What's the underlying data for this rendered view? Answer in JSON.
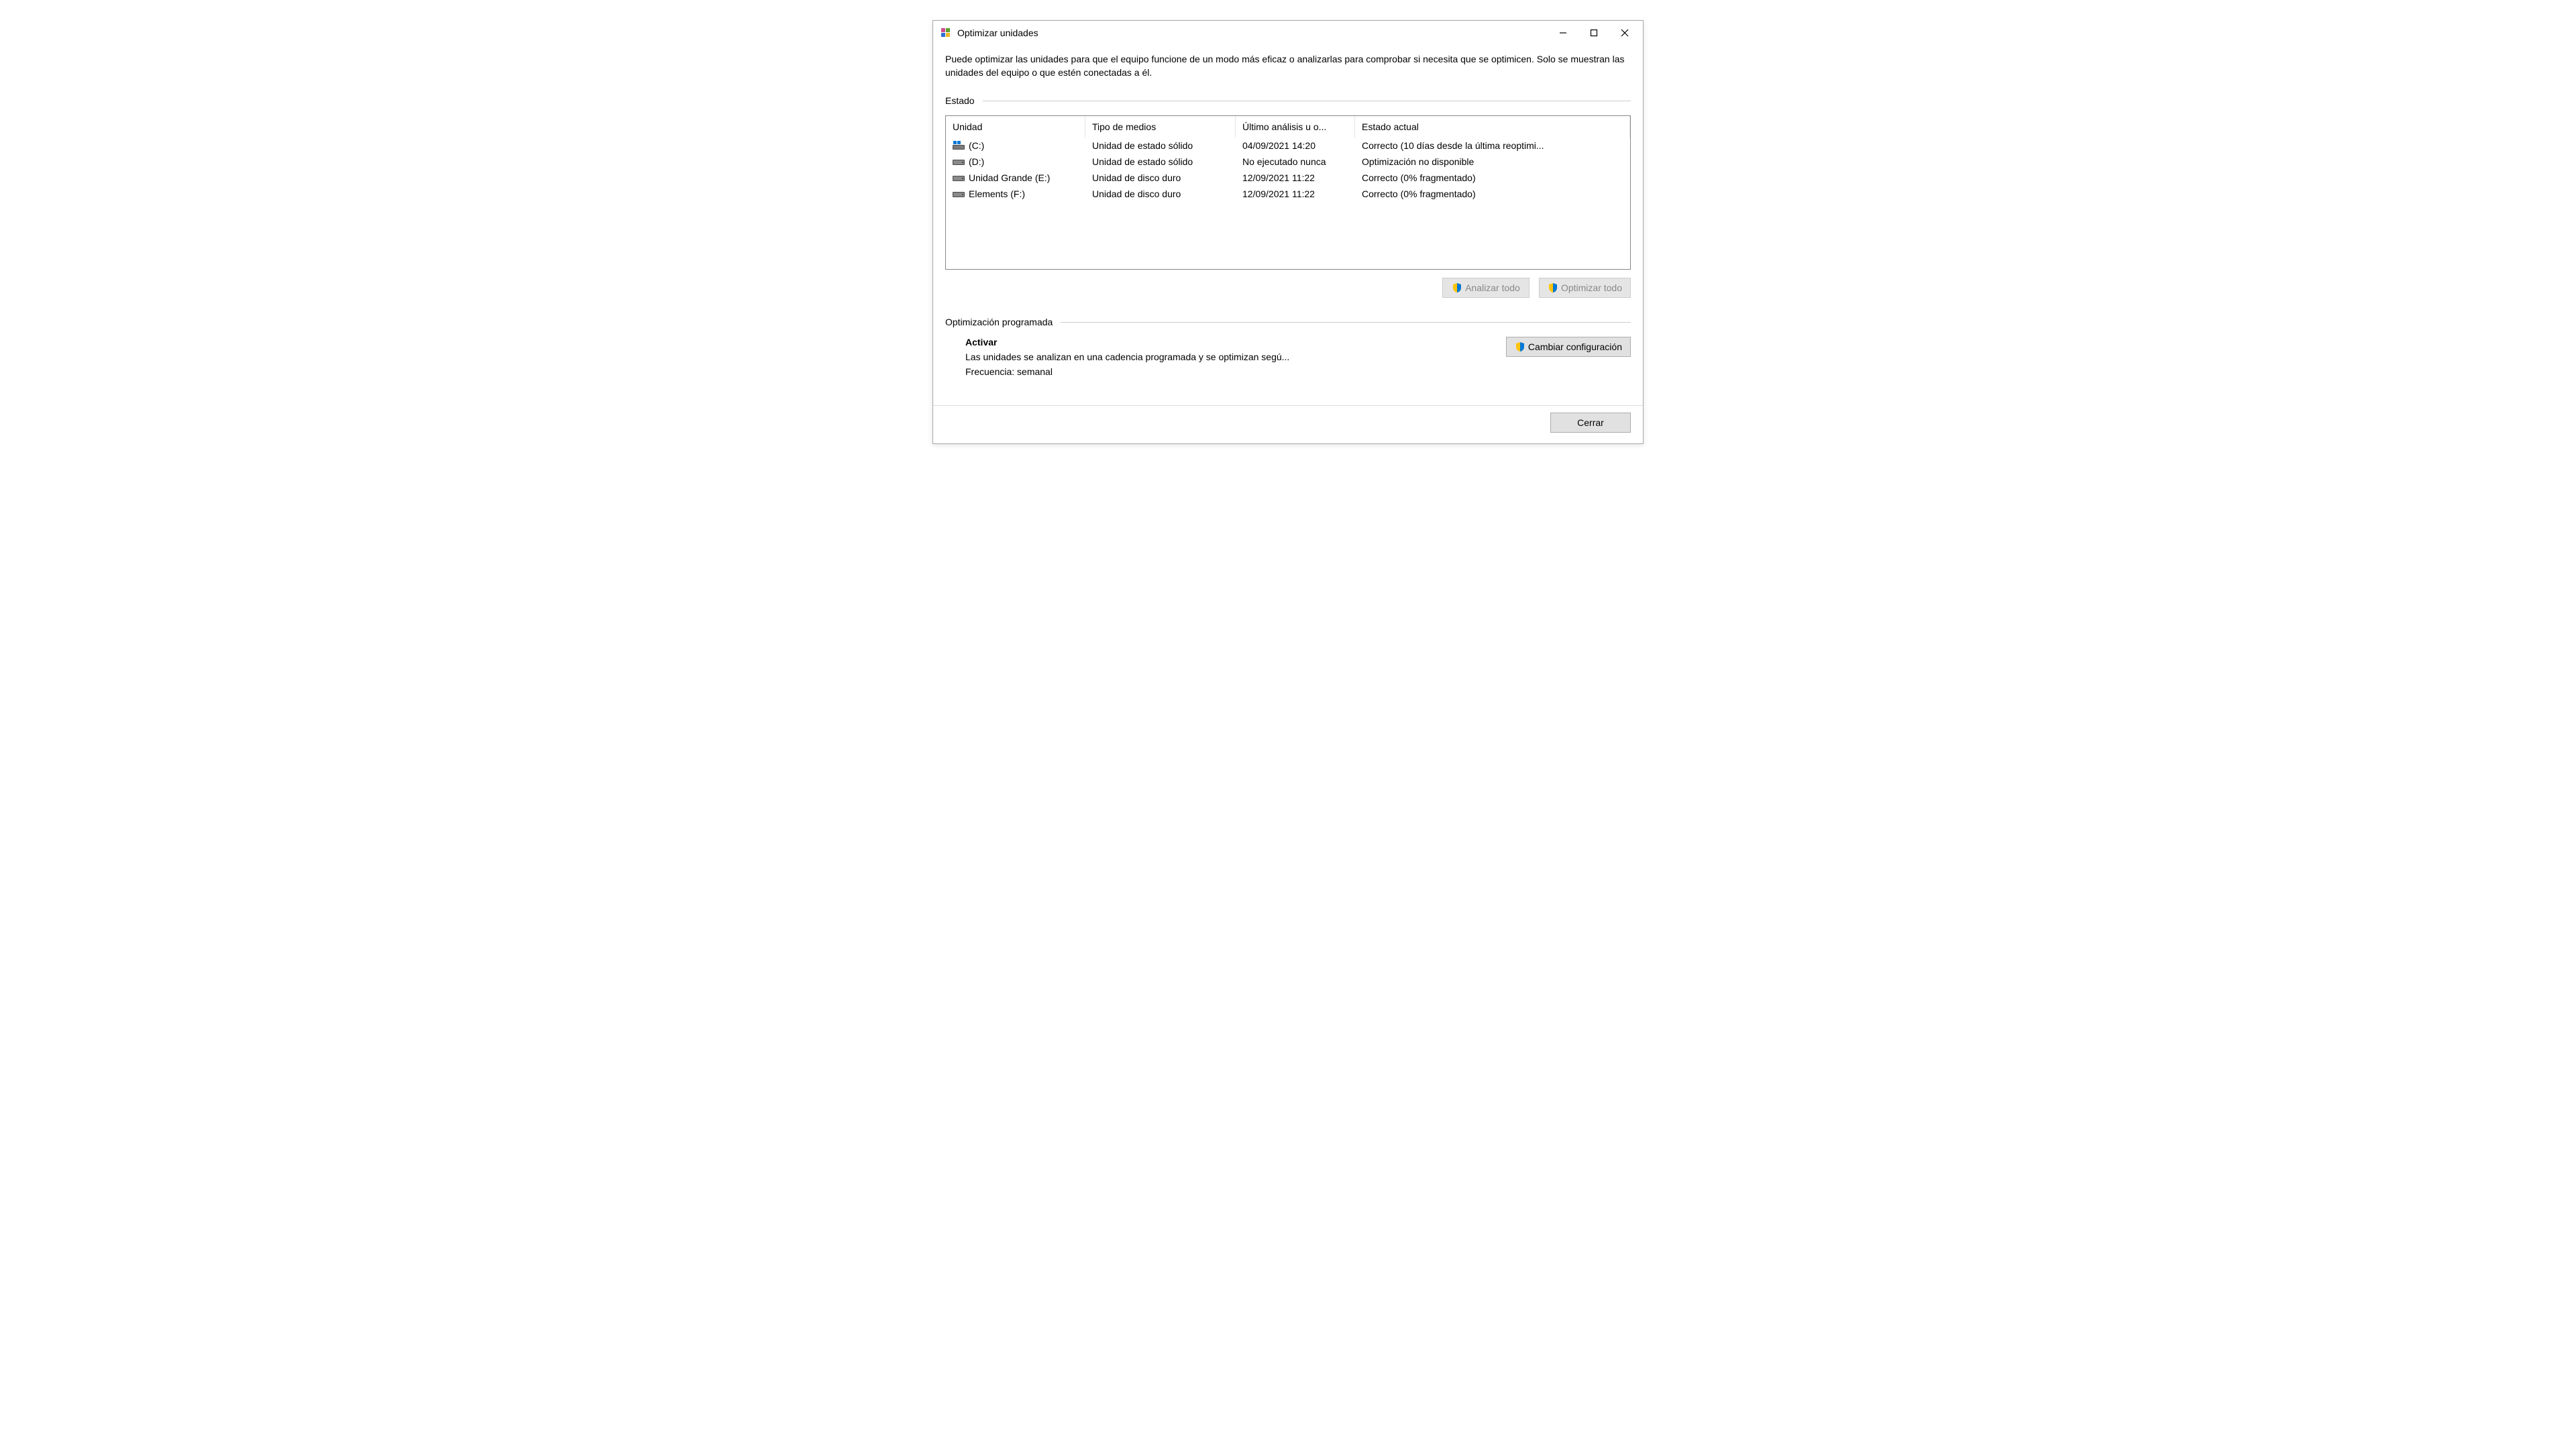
{
  "window": {
    "title": "Optimizar unidades"
  },
  "description": "Puede optimizar las unidades para que el equipo funcione de un modo más eficaz o analizarlas para comprobar si necesita que se optimicen. Solo se muestran las unidades del equipo o que estén conectadas a él.",
  "status_section": {
    "label": "Estado",
    "columns": {
      "unit": "Unidad",
      "media": "Tipo de medios",
      "last": "Último análisis u o...",
      "status": "Estado actual"
    },
    "drives": [
      {
        "icon": "windows-drive",
        "name": "(C:)",
        "media": "Unidad de estado sólido",
        "last": "04/09/2021 14:20",
        "status": "Correcto (10 días desde la última reoptimi..."
      },
      {
        "icon": "hdd",
        "name": "(D:)",
        "media": "Unidad de estado sólido",
        "last": "No ejecutado nunca",
        "status": "Optimización no disponible"
      },
      {
        "icon": "hdd",
        "name": "Unidad Grande (E:)",
        "media": "Unidad de disco duro",
        "last": "12/09/2021 11:22",
        "status": "Correcto (0% fragmentado)"
      },
      {
        "icon": "hdd",
        "name": "Elements (F:)",
        "media": "Unidad de disco duro",
        "last": "12/09/2021 11:22",
        "status": "Correcto (0% fragmentado)"
      }
    ]
  },
  "actions": {
    "analyze_all": "Analizar todo",
    "optimize_all": "Optimizar todo"
  },
  "scheduled": {
    "label": "Optimización programada",
    "title": "Activar",
    "description": "Las unidades se analizan en una cadencia programada y se optimizan segú...",
    "frequency": "Frecuencia: semanal",
    "change_settings": "Cambiar configuración"
  },
  "footer": {
    "close": "Cerrar"
  }
}
